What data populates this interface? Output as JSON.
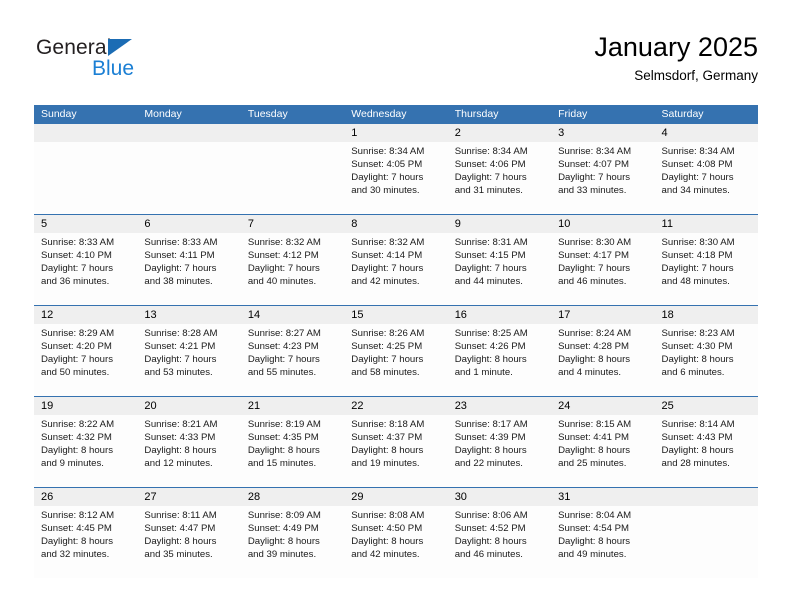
{
  "brand": {
    "name_part1": "General",
    "name_part2": "Blue",
    "triangle_icon": "triangle-right-icon",
    "color_dark": "#231f20",
    "color_blue": "#1b7fd4"
  },
  "header": {
    "title": "January 2025",
    "subtitle": "Selmsdorf, Germany"
  },
  "theme": {
    "header_blue": "#3572b0",
    "date_band_gray": "#efefef",
    "page_background": "#ffffff"
  },
  "calendar": {
    "weekday_headers": [
      "Sunday",
      "Monday",
      "Tuesday",
      "Wednesday",
      "Thursday",
      "Friday",
      "Saturday"
    ],
    "weeks": [
      [
        {
          "day": "",
          "lines": []
        },
        {
          "day": "",
          "lines": []
        },
        {
          "day": "",
          "lines": []
        },
        {
          "day": "1",
          "lines": [
            "Sunrise: 8:34 AM",
            "Sunset: 4:05 PM",
            "Daylight: 7 hours",
            "and 30 minutes."
          ]
        },
        {
          "day": "2",
          "lines": [
            "Sunrise: 8:34 AM",
            "Sunset: 4:06 PM",
            "Daylight: 7 hours",
            "and 31 minutes."
          ]
        },
        {
          "day": "3",
          "lines": [
            "Sunrise: 8:34 AM",
            "Sunset: 4:07 PM",
            "Daylight: 7 hours",
            "and 33 minutes."
          ]
        },
        {
          "day": "4",
          "lines": [
            "Sunrise: 8:34 AM",
            "Sunset: 4:08 PM",
            "Daylight: 7 hours",
            "and 34 minutes."
          ]
        }
      ],
      [
        {
          "day": "5",
          "lines": [
            "Sunrise: 8:33 AM",
            "Sunset: 4:10 PM",
            "Daylight: 7 hours",
            "and 36 minutes."
          ]
        },
        {
          "day": "6",
          "lines": [
            "Sunrise: 8:33 AM",
            "Sunset: 4:11 PM",
            "Daylight: 7 hours",
            "and 38 minutes."
          ]
        },
        {
          "day": "7",
          "lines": [
            "Sunrise: 8:32 AM",
            "Sunset: 4:12 PM",
            "Daylight: 7 hours",
            "and 40 minutes."
          ]
        },
        {
          "day": "8",
          "lines": [
            "Sunrise: 8:32 AM",
            "Sunset: 4:14 PM",
            "Daylight: 7 hours",
            "and 42 minutes."
          ]
        },
        {
          "day": "9",
          "lines": [
            "Sunrise: 8:31 AM",
            "Sunset: 4:15 PM",
            "Daylight: 7 hours",
            "and 44 minutes."
          ]
        },
        {
          "day": "10",
          "lines": [
            "Sunrise: 8:30 AM",
            "Sunset: 4:17 PM",
            "Daylight: 7 hours",
            "and 46 minutes."
          ]
        },
        {
          "day": "11",
          "lines": [
            "Sunrise: 8:30 AM",
            "Sunset: 4:18 PM",
            "Daylight: 7 hours",
            "and 48 minutes."
          ]
        }
      ],
      [
        {
          "day": "12",
          "lines": [
            "Sunrise: 8:29 AM",
            "Sunset: 4:20 PM",
            "Daylight: 7 hours",
            "and 50 minutes."
          ]
        },
        {
          "day": "13",
          "lines": [
            "Sunrise: 8:28 AM",
            "Sunset: 4:21 PM",
            "Daylight: 7 hours",
            "and 53 minutes."
          ]
        },
        {
          "day": "14",
          "lines": [
            "Sunrise: 8:27 AM",
            "Sunset: 4:23 PM",
            "Daylight: 7 hours",
            "and 55 minutes."
          ]
        },
        {
          "day": "15",
          "lines": [
            "Sunrise: 8:26 AM",
            "Sunset: 4:25 PM",
            "Daylight: 7 hours",
            "and 58 minutes."
          ]
        },
        {
          "day": "16",
          "lines": [
            "Sunrise: 8:25 AM",
            "Sunset: 4:26 PM",
            "Daylight: 8 hours",
            "and 1 minute."
          ]
        },
        {
          "day": "17",
          "lines": [
            "Sunrise: 8:24 AM",
            "Sunset: 4:28 PM",
            "Daylight: 8 hours",
            "and 4 minutes."
          ]
        },
        {
          "day": "18",
          "lines": [
            "Sunrise: 8:23 AM",
            "Sunset: 4:30 PM",
            "Daylight: 8 hours",
            "and 6 minutes."
          ]
        }
      ],
      [
        {
          "day": "19",
          "lines": [
            "Sunrise: 8:22 AM",
            "Sunset: 4:32 PM",
            "Daylight: 8 hours",
            "and 9 minutes."
          ]
        },
        {
          "day": "20",
          "lines": [
            "Sunrise: 8:21 AM",
            "Sunset: 4:33 PM",
            "Daylight: 8 hours",
            "and 12 minutes."
          ]
        },
        {
          "day": "21",
          "lines": [
            "Sunrise: 8:19 AM",
            "Sunset: 4:35 PM",
            "Daylight: 8 hours",
            "and 15 minutes."
          ]
        },
        {
          "day": "22",
          "lines": [
            "Sunrise: 8:18 AM",
            "Sunset: 4:37 PM",
            "Daylight: 8 hours",
            "and 19 minutes."
          ]
        },
        {
          "day": "23",
          "lines": [
            "Sunrise: 8:17 AM",
            "Sunset: 4:39 PM",
            "Daylight: 8 hours",
            "and 22 minutes."
          ]
        },
        {
          "day": "24",
          "lines": [
            "Sunrise: 8:15 AM",
            "Sunset: 4:41 PM",
            "Daylight: 8 hours",
            "and 25 minutes."
          ]
        },
        {
          "day": "25",
          "lines": [
            "Sunrise: 8:14 AM",
            "Sunset: 4:43 PM",
            "Daylight: 8 hours",
            "and 28 minutes."
          ]
        }
      ],
      [
        {
          "day": "26",
          "lines": [
            "Sunrise: 8:12 AM",
            "Sunset: 4:45 PM",
            "Daylight: 8 hours",
            "and 32 minutes."
          ]
        },
        {
          "day": "27",
          "lines": [
            "Sunrise: 8:11 AM",
            "Sunset: 4:47 PM",
            "Daylight: 8 hours",
            "and 35 minutes."
          ]
        },
        {
          "day": "28",
          "lines": [
            "Sunrise: 8:09 AM",
            "Sunset: 4:49 PM",
            "Daylight: 8 hours",
            "and 39 minutes."
          ]
        },
        {
          "day": "29",
          "lines": [
            "Sunrise: 8:08 AM",
            "Sunset: 4:50 PM",
            "Daylight: 8 hours",
            "and 42 minutes."
          ]
        },
        {
          "day": "30",
          "lines": [
            "Sunrise: 8:06 AM",
            "Sunset: 4:52 PM",
            "Daylight: 8 hours",
            "and 46 minutes."
          ]
        },
        {
          "day": "31",
          "lines": [
            "Sunrise: 8:04 AM",
            "Sunset: 4:54 PM",
            "Daylight: 8 hours",
            "and 49 minutes."
          ]
        },
        {
          "day": "",
          "lines": []
        }
      ]
    ]
  }
}
